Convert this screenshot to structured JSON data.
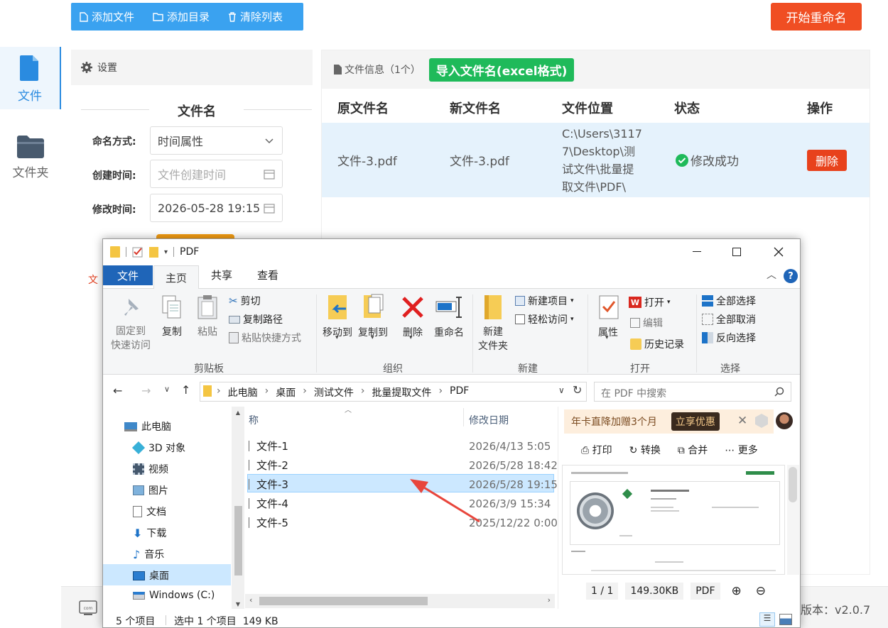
{
  "rail": {
    "file_label": "文件",
    "folder_label": "文件夹"
  },
  "toolbar": {
    "add_file": "添加文件",
    "add_dir": "添加目录",
    "clear_list": "清除列表",
    "start_rename": "开始重命名"
  },
  "settings": {
    "title": "设置",
    "section_title": "文件名",
    "naming_label": "命名方式:",
    "naming_value": "时间属性",
    "created_label": "创建时间:",
    "created_placeholder": "文件创建时间",
    "modified_label": "修改时间:",
    "modified_value": "2026-05-28 19:15",
    "partial_text": "文"
  },
  "file_info": {
    "title": "文件信息（1个）",
    "import_button": "导入文件名(excel格式)",
    "columns": [
      "原文件名",
      "新文件名",
      "文件位置",
      "状态",
      "操作"
    ],
    "row": {
      "original": "文件-3.pdf",
      "new": "文件-3.pdf",
      "location": [
        "C:\\Users\\3117",
        "7\\Desktop\\测",
        "试文件\\批量提",
        "取文件\\PDF\\"
      ],
      "status": "修改成功",
      "action": "删除"
    }
  },
  "footer": {
    "version": "版本：v2.0.7"
  },
  "explorer": {
    "title": "PDF",
    "tabs": [
      "文件",
      "主页",
      "共享",
      "查看"
    ],
    "ribbon": {
      "pin": [
        "固定到",
        "快速访问"
      ],
      "copy": "复制",
      "paste": "粘贴",
      "cut": "剪切",
      "copy_path": "复制路径",
      "paste_shortcut": "粘贴快捷方式",
      "clipboard_group": "剪贴板",
      "move_to": "移动到",
      "copy_to": "复制到",
      "delete": "删除",
      "rename": "重命名",
      "organize_group": "组织",
      "new_folder": [
        "新建",
        "文件夹"
      ],
      "new_item": "新建项目",
      "easy_access": "轻松访问",
      "new_group": "新建",
      "properties": "属性",
      "open": "打开",
      "edit": "编辑",
      "history": "历史记录",
      "open_group": "打开",
      "select_all": "全部选择",
      "select_none": "全部取消",
      "invert": "反向选择",
      "select_group": "选择"
    },
    "breadcrumb": [
      "此电脑",
      "桌面",
      "测试文件",
      "批量提取文件",
      "PDF"
    ],
    "search_placeholder": "在 PDF 中搜索",
    "nav": [
      "此电脑",
      "3D 对象",
      "视频",
      "图片",
      "文档",
      "下载",
      "音乐",
      "桌面",
      "Windows (C:)"
    ],
    "col_name": "称",
    "col_date": "修改日期",
    "files": [
      {
        "name": "文件-1",
        "date": "2026/4/13 5:05"
      },
      {
        "name": "文件-2",
        "date": "2026/5/28 18:42"
      },
      {
        "name": "文件-3",
        "date": "2026/5/28 19:15"
      },
      {
        "name": "文件-4",
        "date": "2026/3/9 15:34"
      },
      {
        "name": "文件-5",
        "date": "2025/12/22 0:00"
      }
    ],
    "promo": {
      "text": "年卡直降加赠3个月",
      "button": "立享优惠"
    },
    "preview_actions": [
      "打印",
      "转换",
      "合并",
      "更多"
    ],
    "preview_footer": {
      "page": "1 / 1",
      "size": "149.30KB",
      "type": "PDF"
    },
    "status": {
      "count": "5 个项目",
      "selected": "选中 1 个项目  149 KB"
    }
  }
}
